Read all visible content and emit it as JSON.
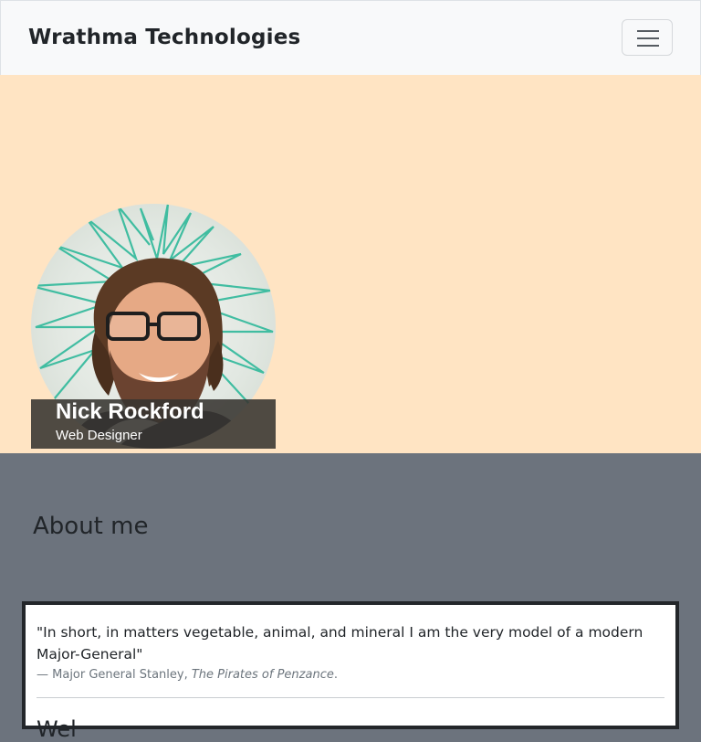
{
  "navbar": {
    "brand": "Wrathma Technologies",
    "toggle_icon": "hamburger-menu-icon"
  },
  "hero": {
    "background_color": "#ffe4c3",
    "profile": {
      "image": "profile-photo",
      "name": "Nick Rockford",
      "title": "Web Designer"
    }
  },
  "about": {
    "heading": "About me",
    "quote": {
      "text": "\"In short, in matters vegetable, animal, and mineral I am the very model of a modern Major-General\"",
      "attribution_prefix": "— Major General Stanley, ",
      "source": "The Pirates of Penzance",
      "source_suffix": "."
    },
    "next_heading_partial": "Wel"
  },
  "colors": {
    "navbar_bg": "#f8f9fa",
    "hero_bg": "#ffe4c3",
    "about_bg": "#6c737d",
    "card_border": "#23262a"
  }
}
